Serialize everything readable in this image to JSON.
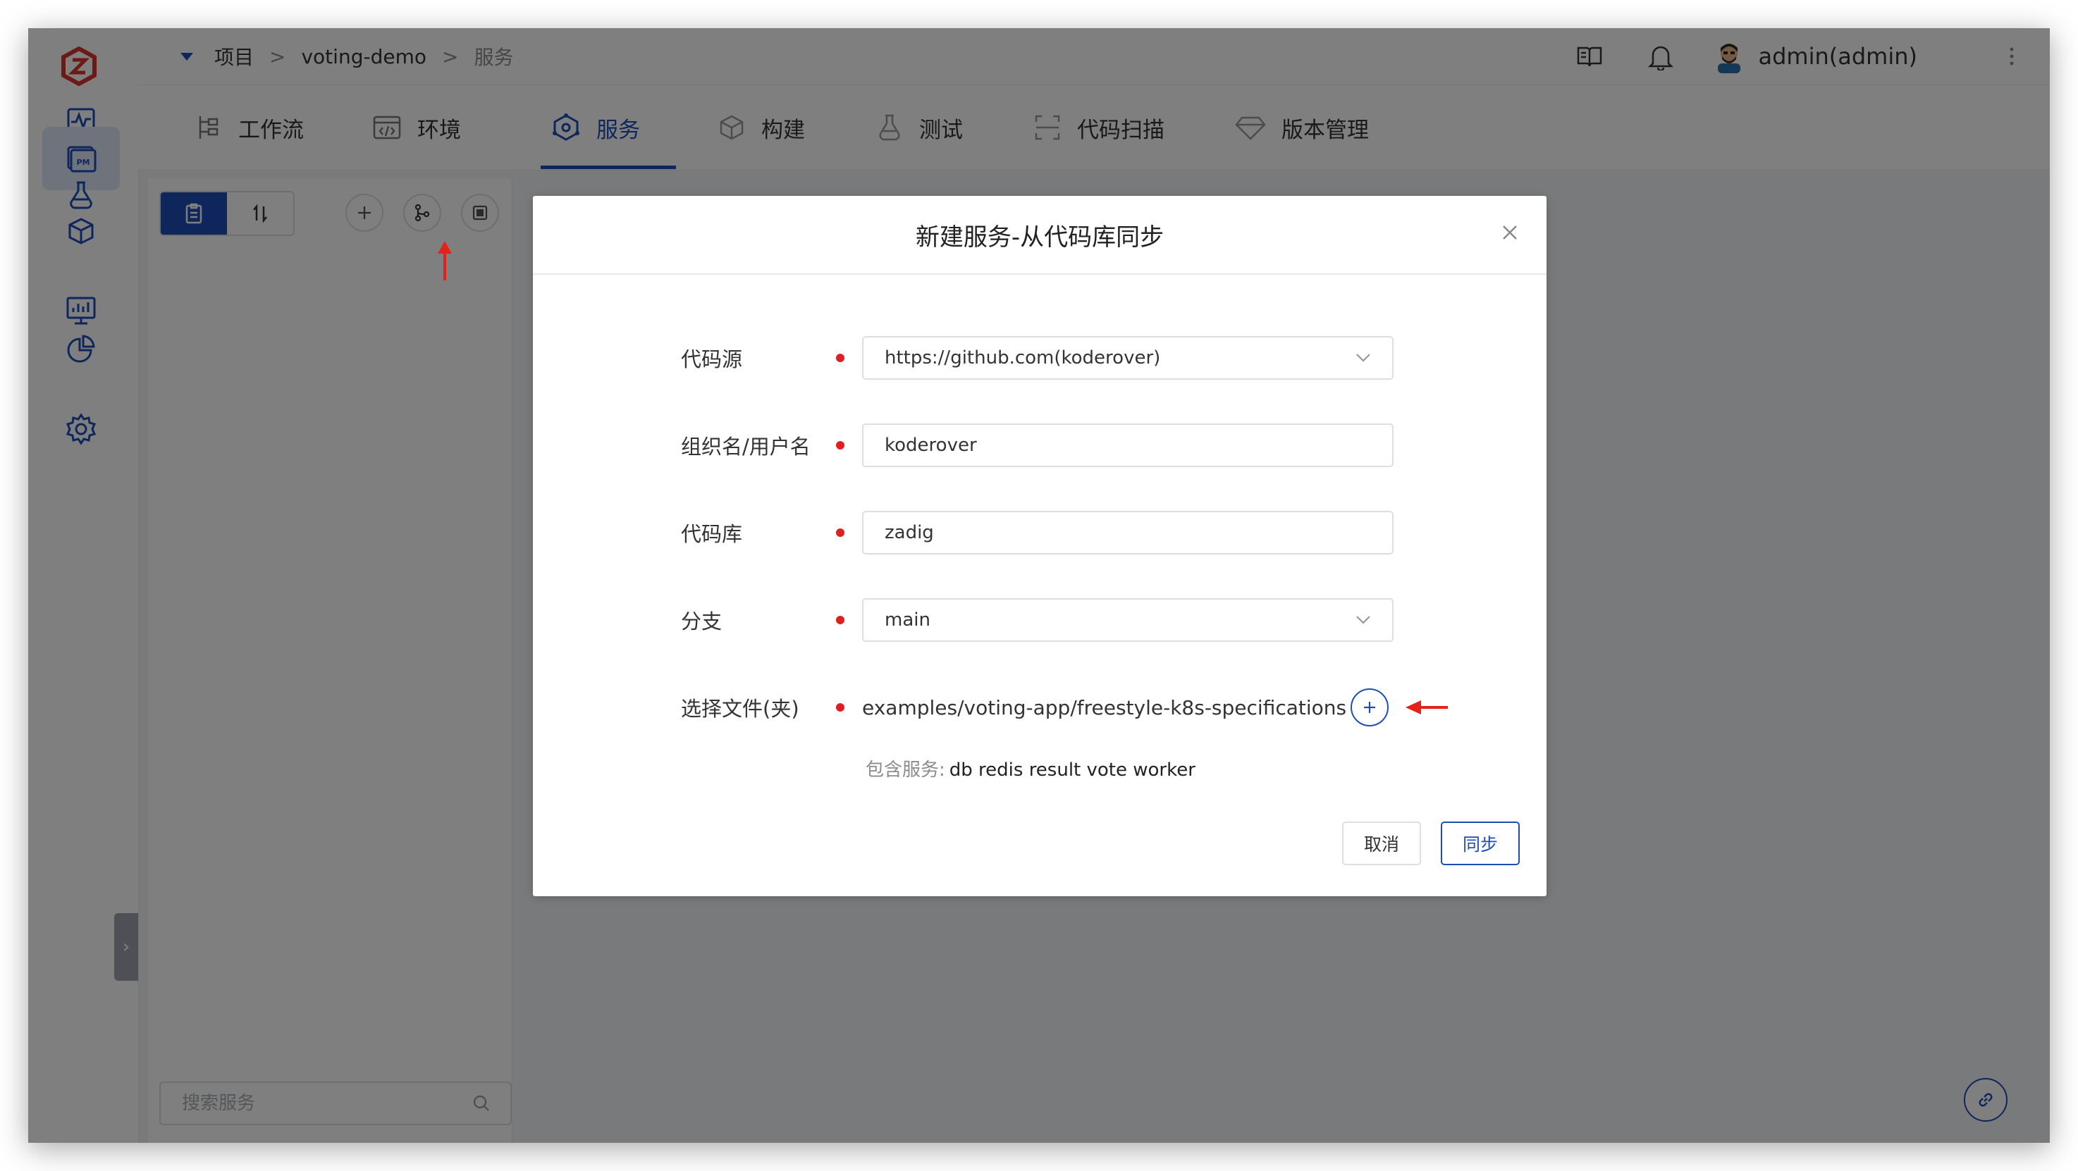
{
  "colors": {
    "accent": "#1f4db8",
    "logo": "#d9342b",
    "annotation_arrow": "#e3231b",
    "required_dot": "#e02020"
  },
  "breadcrumb": {
    "project": "项目",
    "sep1": ">",
    "project_name": "voting-demo",
    "sep2": ">",
    "current": "服务"
  },
  "user": {
    "name": "admin(admin)"
  },
  "topbar_icons": [
    "docs-icon",
    "bell-icon",
    "avatar",
    "more-icon"
  ],
  "rail_icons": [
    "activity-icon",
    "pm-icon",
    "flask-icon",
    "package-icon",
    "monitor-icon",
    "pie-chart-icon",
    "settings-icon"
  ],
  "tabs": [
    {
      "label": "工作流",
      "icon": "workflow-icon"
    },
    {
      "label": "环境",
      "icon": "env-icon"
    },
    {
      "label": "服务",
      "icon": "service-icon",
      "active": true
    },
    {
      "label": "构建",
      "icon": "build-icon"
    },
    {
      "label": "测试",
      "icon": "test-icon"
    },
    {
      "label": "代码扫描",
      "icon": "scan-icon"
    },
    {
      "label": "版本管理",
      "icon": "version-icon"
    }
  ],
  "service_panel": {
    "search_placeholder": "搜索服务"
  },
  "modal": {
    "title": "新建服务-从代码库同步",
    "fields": [
      {
        "label": "代码源",
        "value": "https://github.com(koderover)",
        "type": "select"
      },
      {
        "label": "组织名/用户名",
        "value": "koderover",
        "type": "input"
      },
      {
        "label": "代码库",
        "value": "zadig",
        "type": "input"
      },
      {
        "label": "分支",
        "value": "main",
        "type": "select"
      },
      {
        "label": "选择文件(夹)",
        "value": "examples/voting-app/freestyle-k8s-specifications",
        "type": "path"
      }
    ],
    "included_label": "包含服务:",
    "included_value": "db redis result vote worker",
    "cancel_label": "取消",
    "sync_label": "同步"
  }
}
